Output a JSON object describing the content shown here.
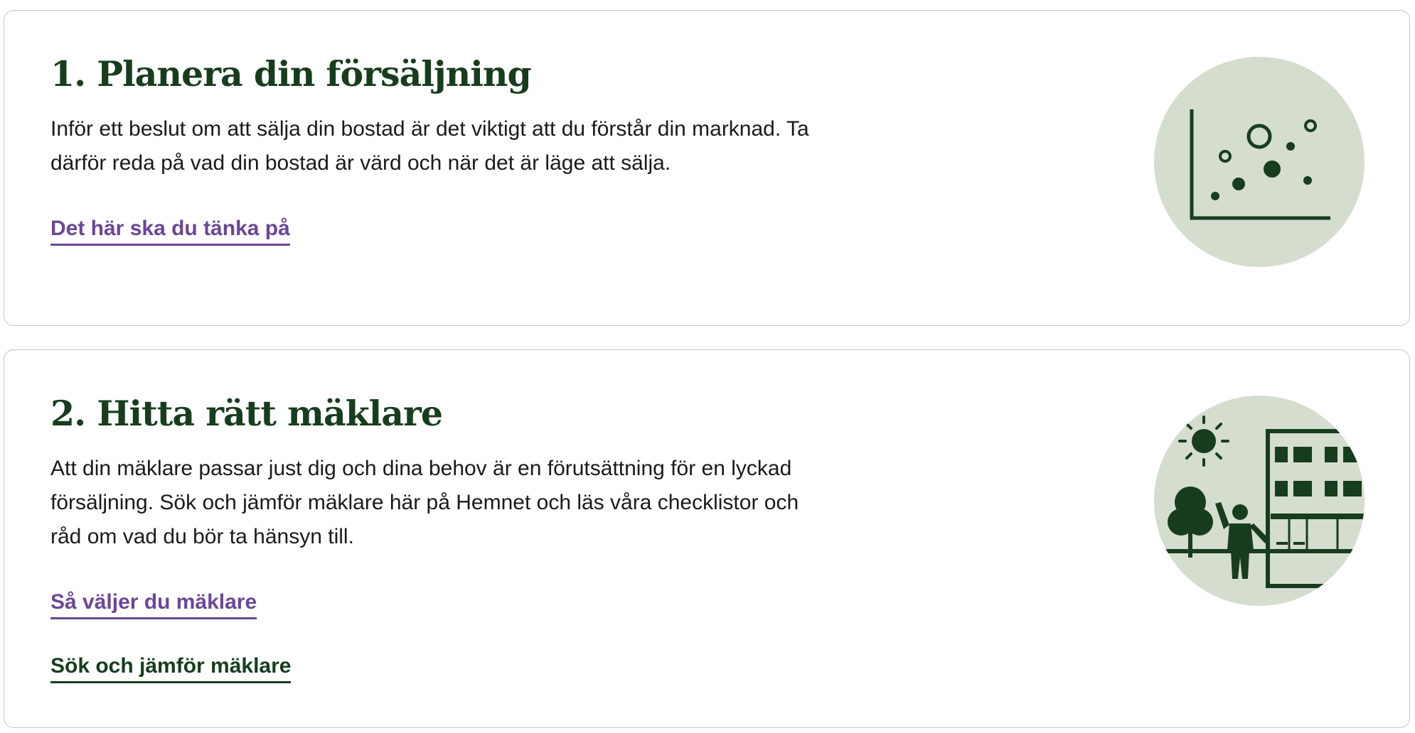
{
  "steps": [
    {
      "title": "1. Planera din försäljning",
      "description": "Inför ett beslut om att sälja din bostad är det viktigt att du förstår din marknad. Ta därför reda på vad din bostad är värd och när det är läge att sälja.",
      "links": [
        {
          "label": "Det här ska du tänka på"
        }
      ],
      "illustration_icon": "scatter-chart-icon"
    },
    {
      "title": "2. Hitta rätt mäklare",
      "description": "Att din mäklare passar just dig och dina behov är en förutsättning för en lyckad försäljning. Sök och jämför mäklare här på Hemnet och läs våra checklistor och råd om vad du bör ta hänsyn till.",
      "links": [
        {
          "label": "Så väljer du mäklare"
        },
        {
          "label": "Sök och jämför mäklare"
        }
      ],
      "illustration_icon": "neighborhood-agent-icon"
    }
  ],
  "colors": {
    "heading": "#173d1e",
    "body_text": "#1a1a1a",
    "link_primary": "#6b4796",
    "link_secondary": "#173d1e",
    "illustration_bg": "#d5ddcf",
    "illustration_fg": "#173d1e",
    "card_border": "#c4c4c4"
  }
}
